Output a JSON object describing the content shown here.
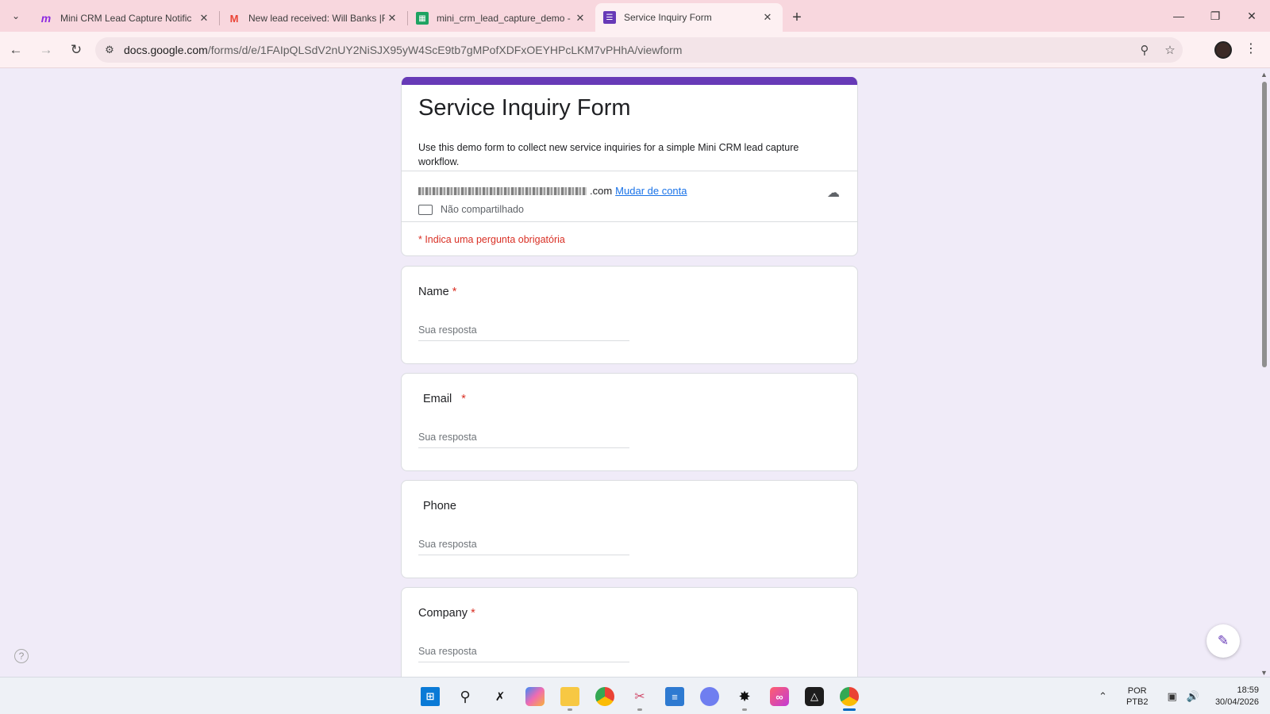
{
  "browser": {
    "tabs": [
      {
        "title": "Mini CRM Lead Capture Notific",
        "favicon": "make-icon",
        "active": false
      },
      {
        "title": "New lead received: Will Banks |F",
        "favicon": "gmail-icon",
        "active": false
      },
      {
        "title": "mini_crm_lead_capture_demo -",
        "favicon": "sheets-icon",
        "active": false
      },
      {
        "title": "Service Inquiry Form",
        "favicon": "forms-icon",
        "active": true
      }
    ],
    "url_host": "docs.google.com",
    "url_path": "/forms/d/e/1FAIpQLSdV2nUY2NiSJX95yW4ScE9tb7gMPofXDFxOEYHPcLKM7vPHhA/viewform"
  },
  "form": {
    "title": "Service Inquiry Form",
    "description": "Use this demo form to collect new service inquiries for a simple Mini CRM lead capture workflow.",
    "account_domain_suffix": ".com",
    "switch_account": "Mudar de conta",
    "not_shared": "Não compartilhado",
    "required_note": "* Indica uma pergunta obrigatória",
    "questions": [
      {
        "label": "Name",
        "required": "*",
        "placeholder": "Sua resposta"
      },
      {
        "label": "Email",
        "required": "*",
        "placeholder": "Sua resposta"
      },
      {
        "label": "Phone",
        "required": "",
        "placeholder": "Sua resposta"
      },
      {
        "label": "Company",
        "required": "*",
        "placeholder": "Sua resposta"
      }
    ]
  },
  "taskbar": {
    "lang_top": "POR",
    "lang_bottom": "PTB2",
    "time": "18:59",
    "date": "30/04/2026"
  }
}
